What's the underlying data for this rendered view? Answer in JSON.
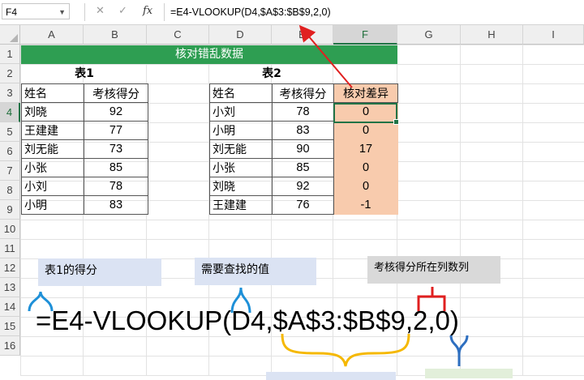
{
  "formula_bar": {
    "name_box": "F4",
    "cancel_icon": "✕",
    "enter_icon": "✓",
    "fx_label": "fx",
    "formula": "=E4-VLOOKUP(D4,$A$3:$B$9,2,0)"
  },
  "columns": [
    "A",
    "B",
    "C",
    "D",
    "E",
    "F",
    "G",
    "H",
    "I"
  ],
  "rows": [
    "1",
    "2",
    "3",
    "4",
    "5",
    "6",
    "7",
    "8",
    "9",
    "10",
    "11",
    "12",
    "13",
    "14",
    "15",
    "16"
  ],
  "selected_cell": {
    "column": "F",
    "row": "4"
  },
  "sheet_title": "核对错乱数据",
  "table1": {
    "label": "表1",
    "headers": [
      "姓名",
      "考核得分"
    ],
    "rows": [
      {
        "name": "刘晓",
        "score": "92"
      },
      {
        "name": "王建建",
        "score": "77"
      },
      {
        "name": "刘无能",
        "score": "73"
      },
      {
        "name": "小张",
        "score": "85"
      },
      {
        "name": "小刘",
        "score": "78"
      },
      {
        "name": "小明",
        "score": "83"
      }
    ]
  },
  "table2": {
    "label": "表2",
    "headers": [
      "姓名",
      "考核得分",
      "核对差异"
    ],
    "rows": [
      {
        "name": "小刘",
        "score": "78",
        "diff": "0"
      },
      {
        "name": "小明",
        "score": "83",
        "diff": "0"
      },
      {
        "name": "刘无能",
        "score": "90",
        "diff": "17"
      },
      {
        "name": "小张",
        "score": "85",
        "diff": "0"
      },
      {
        "name": "刘晓",
        "score": "92",
        "diff": "0"
      },
      {
        "name": "王建建",
        "score": "76",
        "diff": "-1"
      }
    ]
  },
  "annotations": {
    "note_table1_score": "表1的得分",
    "note_lookup_value": "需要查找的值",
    "note_column_index": "考核得分所在列数列",
    "big_formula": "=E4-VLOOKUP(D4,$A$3:$B$9,2,0)"
  },
  "colors": {
    "title_bg": "#2e9e52",
    "diff_bg": "#f8cbad",
    "arrow_red": "#e02020",
    "brace_blue": "#1e90d8",
    "brace_yellow": "#f5b800",
    "brace_red": "#e02020",
    "brace_darkblue": "#2e6fc0"
  }
}
